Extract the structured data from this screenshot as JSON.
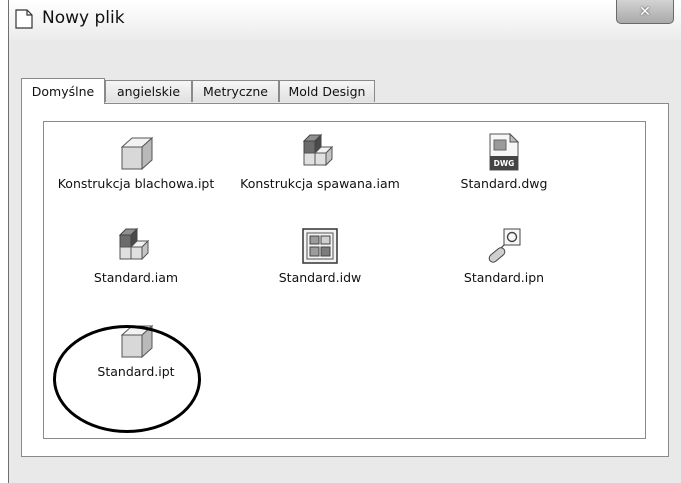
{
  "window": {
    "title": "Nowy plik",
    "close_glyph": "✕"
  },
  "tabs": [
    {
      "label": "Domyślne",
      "active": true
    },
    {
      "label": "angielskie",
      "active": false
    },
    {
      "label": "Metryczne",
      "active": false
    },
    {
      "label": "Mold Design",
      "active": false
    }
  ],
  "templates": [
    {
      "name": "Konstrukcja blachowa.ipt",
      "icon": "part-cube-icon"
    },
    {
      "name": "Konstrukcja spawana.iam",
      "icon": "assembly-icon"
    },
    {
      "name": "Standard.dwg",
      "icon": "dwg-drawing-icon",
      "badge": "DWG"
    },
    {
      "name": "Standard.iam",
      "icon": "assembly-icon"
    },
    {
      "name": "Standard.idw",
      "icon": "idw-drawing-icon"
    },
    {
      "name": "Standard.ipn",
      "icon": "presentation-icon"
    },
    {
      "name": "Standard.ipt",
      "icon": "part-cube-icon",
      "highlighted": true
    }
  ]
}
